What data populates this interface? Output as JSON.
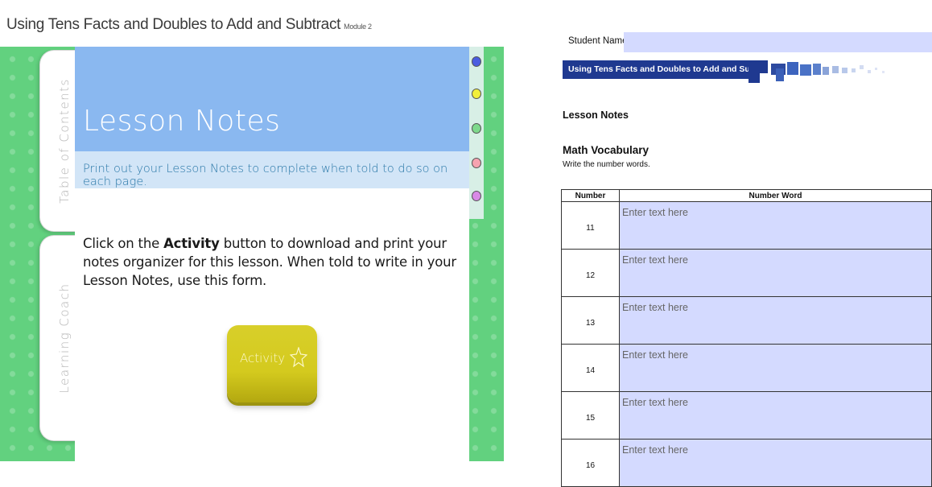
{
  "app": {
    "course_title": "Using Tens Facts and Doubles to Add and Subtract",
    "module": "Module 2"
  },
  "tabs": {
    "table_of_contents": "Table of Contents",
    "learning_coach": "Learning Coach"
  },
  "lesson": {
    "title": "Lesson Notes",
    "subtitle": "Print out your Lesson Notes to complete when told to do so on each page.",
    "instructions_before": "Click on the ",
    "instructions_bold": "Activity",
    "instructions_after": " button to download and print your notes organizer for this lesson. When told to write in your Lesson Notes, use this form.",
    "activity_button_label": "Activity"
  },
  "nav_dots": [
    {
      "name": "blue",
      "color": "#4a5de0"
    },
    {
      "name": "yellow",
      "color": "#f2ef3a"
    },
    {
      "name": "green",
      "color": "#7ed98c"
    },
    {
      "name": "pink",
      "color": "#f6a3b0"
    },
    {
      "name": "purple",
      "color": "#d98ae6"
    }
  ],
  "worksheet": {
    "student_name_label": "Student Name:",
    "banner_title": "Using Tens Facts and Doubles to Add and Subtract",
    "lesson_notes_heading": "Lesson Notes",
    "vocab_heading": "Math Vocabulary",
    "instruction": "Write the number words.",
    "table_headers": [
      "Number",
      "Number Word"
    ],
    "rows": [
      {
        "number": "11",
        "placeholder": "Enter text here"
      },
      {
        "number": "12",
        "placeholder": "Enter text here"
      },
      {
        "number": "13",
        "placeholder": "Enter text here"
      },
      {
        "number": "14",
        "placeholder": "Enter text here"
      },
      {
        "number": "15",
        "placeholder": "Enter text here"
      },
      {
        "number": "16",
        "placeholder": "Enter text here"
      }
    ]
  }
}
